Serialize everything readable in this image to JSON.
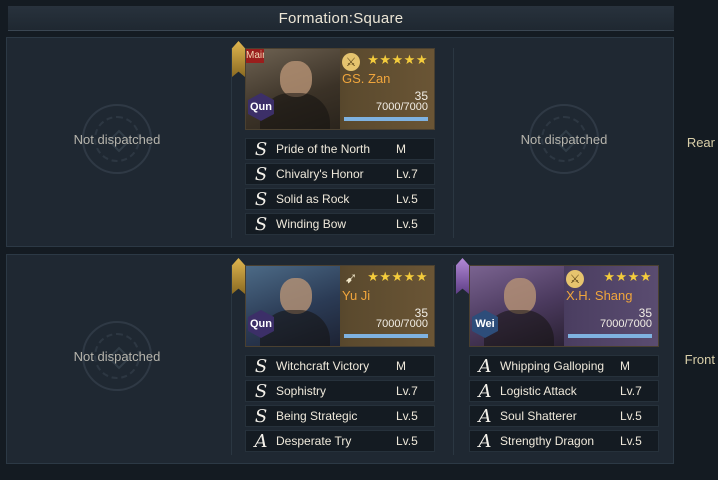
{
  "title": "Formation:Square",
  "rows": {
    "rear": {
      "label": "Rear"
    },
    "front": {
      "label": "Front"
    }
  },
  "empty_slot_text": "Not dispatched",
  "heroes": {
    "zan": {
      "main_tag": "Main",
      "name": "GS. Zan",
      "faction": "Qun",
      "stars": "★★★★★",
      "level": "35",
      "troops": "7000/7000",
      "troop_fraction": 1.0,
      "weapon_icon": "whip-icon",
      "skills": [
        {
          "grade": "S",
          "name": "Pride of the North",
          "level": "M"
        },
        {
          "grade": "S",
          "name": "Chivalry's Honor",
          "level": "Lv.7"
        },
        {
          "grade": "S",
          "name": "Solid as Rock",
          "level": "Lv.5"
        },
        {
          "grade": "S",
          "name": "Winding Bow",
          "level": "Lv.5"
        }
      ]
    },
    "yuji": {
      "name": "Yu Ji",
      "faction": "Qun",
      "stars": "★★★★★",
      "level": "35",
      "troops": "7000/7000",
      "troop_fraction": 1.0,
      "weapon_icon": "bow-icon",
      "skills": [
        {
          "grade": "S",
          "name": "Witchcraft Victory",
          "level": "M"
        },
        {
          "grade": "S",
          "name": "Sophistry",
          "level": "Lv.7"
        },
        {
          "grade": "S",
          "name": "Being Strategic",
          "level": "Lv.5"
        },
        {
          "grade": "A",
          "name": "Desperate Try",
          "level": "Lv.5"
        }
      ]
    },
    "shang": {
      "name": "X.H. Shang",
      "faction": "Wei",
      "stars": "★★★★",
      "level": "35",
      "troops": "7000/7000",
      "troop_fraction": 1.0,
      "weapon_icon": "whip-icon",
      "skills": [
        {
          "grade": "A",
          "name": "Whipping Galloping",
          "level": "M"
        },
        {
          "grade": "A",
          "name": "Logistic Attack",
          "level": "Lv.7"
        },
        {
          "grade": "A",
          "name": "Soul Shatterer",
          "level": "Lv.5"
        },
        {
          "grade": "A",
          "name": "Strengthy Dragon",
          "level": "Lv.5"
        }
      ]
    }
  },
  "colors": {
    "hero_name": "#f0a53c",
    "stars": "#f4cc3c",
    "row_label": "#d9cfa9",
    "troop_bar": "#7fb2e0"
  }
}
